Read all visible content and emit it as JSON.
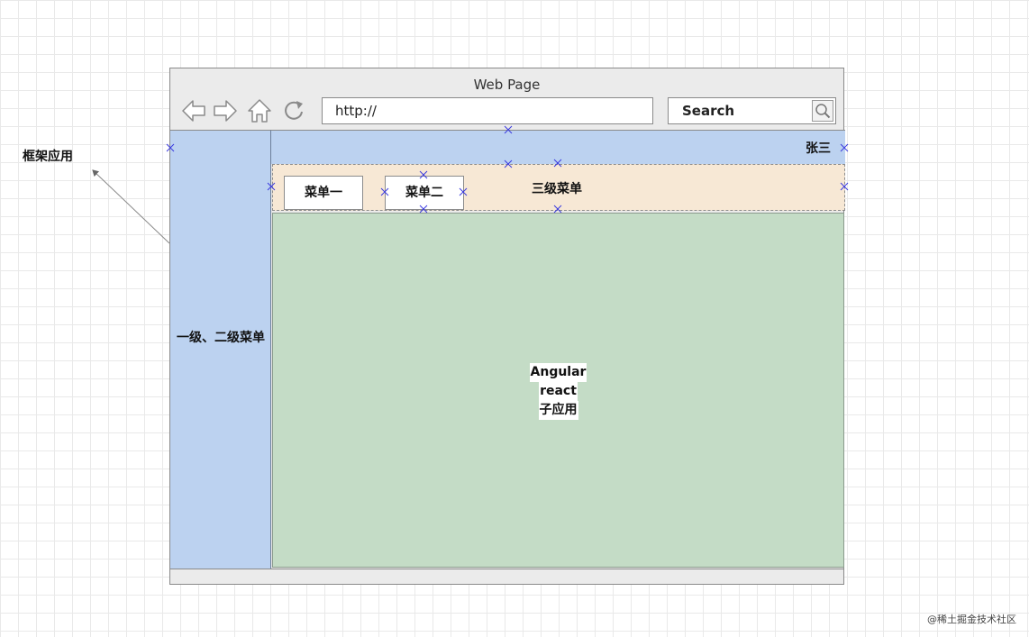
{
  "annotation": {
    "label": "框架应用"
  },
  "browser": {
    "title": "Web Page",
    "url": "http://",
    "search_label": "Search",
    "nav_icons": [
      "back-arrow-icon",
      "forward-arrow-icon",
      "home-icon",
      "refresh-icon"
    ],
    "search_icon": "magnifier-icon"
  },
  "side_menu": {
    "label": "一级、二级菜单"
  },
  "header": {
    "user": "张三"
  },
  "third_menu": {
    "label": "三级菜单",
    "items": [
      "菜单一",
      "菜单二"
    ]
  },
  "sub_app": {
    "lines": [
      "Angular",
      "react",
      "子应用"
    ]
  },
  "watermark": "@稀土掘金技术社区",
  "colors": {
    "menu_blue": "#bcd2f0",
    "menu_beige": "#f7e8d5",
    "subapp_green": "#c4dcc6",
    "handle_blue": "#3a3adf"
  }
}
